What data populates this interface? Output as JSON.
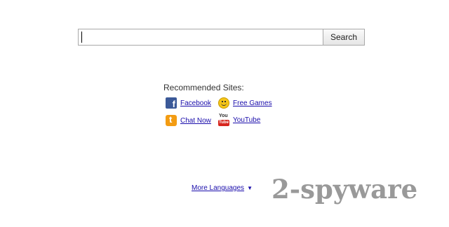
{
  "search": {
    "value": "",
    "button_label": "Search"
  },
  "recommended": {
    "heading": "Recommended Sites:",
    "sites": [
      {
        "label": "Facebook",
        "icon": "facebook-icon",
        "color": "#3b5998"
      },
      {
        "label": "Free Games",
        "icon": "smiley-icon",
        "color": "#f5c518"
      },
      {
        "label": "Chat Now",
        "icon": "chat-icon",
        "color": "#f39c12"
      },
      {
        "label": "YouTube",
        "icon": "youtube-icon",
        "color": "#d7261e"
      }
    ]
  },
  "footer": {
    "more_languages": "More Languages",
    "arrow": "▼"
  },
  "watermark": {
    "text": "2-spyware"
  },
  "colors": {
    "link": "#1a0dab",
    "watermark": "#8f8f8f"
  }
}
